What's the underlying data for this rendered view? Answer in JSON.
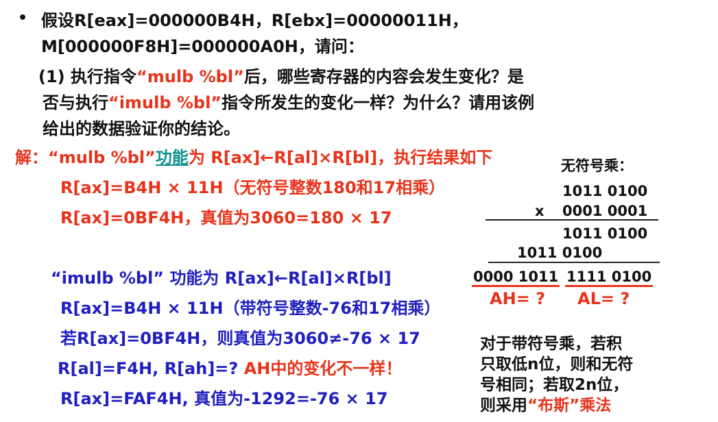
{
  "question": {
    "bullet": "•",
    "line1": "假设R[eax]=000000B4H，R[ebx]=00000011H，",
    "line2": "M[000000F8H]=000000A0H，请问：",
    "p1_line1_a": "(1) 执行指令",
    "p1_line1_b": "“mulb %bl”",
    "p1_line1_c": "后，哪些寄存器的内容会发生变化？是",
    "p1_line2_a": "否与执行",
    "p1_line2_b": "“imulb %bl”",
    "p1_line2_c": "指令所发生的变化一样？为什么？请用该例",
    "p1_line3": "给出的数据验证你的结论。"
  },
  "answer": {
    "prefix": "解：",
    "mul_head": "“mulb %bl”",
    "func_link": "功能",
    "mul_rest": "为 R[ax]←R[al]×R[bl]，执行结果如下",
    "mul_line1": "R[ax]=B4H × 11H（无符号整数180和17相乘）",
    "mul_line2": "R[ax]=0BF4H，真值为3060=180 × 17",
    "imul_head": "“imulb %bl”  功能为 R[ax]←R[al]×R[bl]",
    "imul_line1": "R[ax]=B4H × 11H（带符号整数-76和17相乘）",
    "imul_line2": "若R[ax]=0BF4H，则真值为3060≠-76 × 17",
    "imul_line3_a": "R[al]=F4H, R[ah]=? ",
    "imul_line3_b": "AH中的变化不一样！",
    "imul_line4": "R[ax]=FAF4H, 真值为-1292=-76 × 17"
  },
  "calc": {
    "title": "无符号乘：",
    "row1": "1011 0100",
    "op": "x",
    "row2": "0001 0001",
    "partial1": "1011 0100",
    "partial2": "1011 0100",
    "result_hi": "0000 1011",
    "result_lo": "1111 0100",
    "ah_label": "AH= ?",
    "al_label": "AL= ?"
  },
  "note": {
    "line1": "对于带符号乘，若积",
    "line2": "只取低n位，则和无符",
    "line3": "号相同；若取2n位，",
    "line4_a": "则采用",
    "line4_b": "“布斯”乘法"
  },
  "colors": {
    "text": "#111111",
    "red": "#e8331b",
    "blue": "#1f1fc0",
    "teal_link": "#0d8f8f"
  }
}
